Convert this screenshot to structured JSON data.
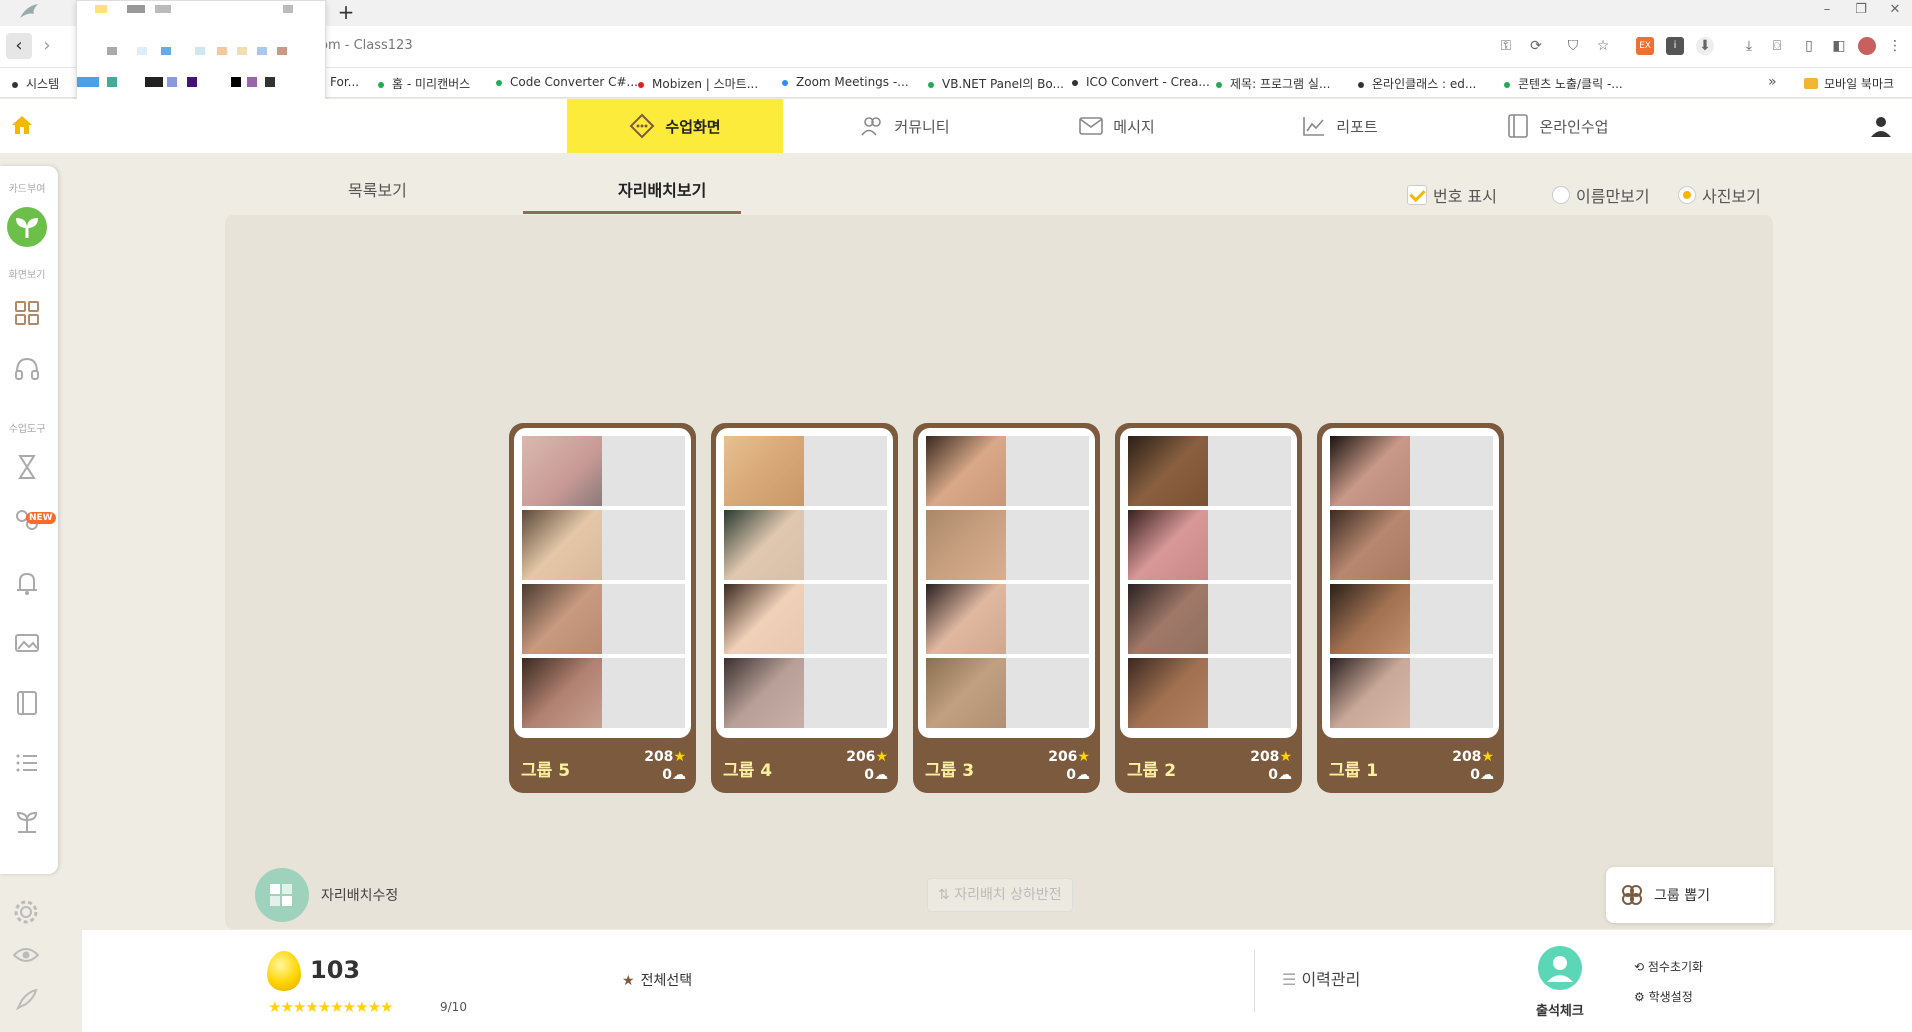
{
  "browser": {
    "tab_new": "+",
    "url": "om - Class123",
    "window_controls": {
      "minimize": "–",
      "restore": "❐",
      "close": "✕"
    },
    "bookmarks": [
      {
        "label": "시스템",
        "dot": "#333333"
      },
      {
        "label": "For...",
        "dot": "#333333"
      },
      {
        "label": "홈 - 미리캔버스",
        "dot": "#22aa55"
      },
      {
        "label": "Code Converter C#...",
        "dot": "#22aa55"
      },
      {
        "label": "Mobizen | 스마트...",
        "dot": "#e02020"
      },
      {
        "label": "Zoom Meetings -...",
        "dot": "#2d8cff"
      },
      {
        "label": "VB.NET Panel의 Bo...",
        "dot": "#22aa55"
      },
      {
        "label": "ICO Convert - Crea...",
        "dot": "#333333"
      },
      {
        "label": "제목: 프로그램 실...",
        "dot": "#22aa55"
      },
      {
        "label": "온라인클래스 : ed...",
        "dot": "#333333"
      },
      {
        "label": "콘텐츠 노출/클릭 -...",
        "dot": "#22aa55"
      }
    ],
    "bookmarks_more": "»",
    "bookmarks_mobile": "모바일 북마크"
  },
  "header": {
    "nav": [
      {
        "label": "수업화면",
        "active": true,
        "icon": "class-screen-icon"
      },
      {
        "label": "커뮤니티",
        "active": false,
        "icon": "community-icon"
      },
      {
        "label": "메시지",
        "active": false,
        "icon": "message-icon"
      },
      {
        "label": "리포트",
        "active": false,
        "icon": "report-icon"
      },
      {
        "label": "온라인수업",
        "active": false,
        "icon": "online-class-icon"
      }
    ]
  },
  "sidebar": {
    "label_card": "카드부여",
    "label_view": "화면보기",
    "label_tools": "수업도구",
    "new_badge": "NEW"
  },
  "view": {
    "tab_list": "목록보기",
    "tab_seat": "자리배치보기",
    "opt_number": "번호 표시",
    "opt_name_only": "이름만보기",
    "opt_photo": "사진보기"
  },
  "groups": [
    {
      "name": "그룹 5",
      "stars": "208",
      "clouds": "0"
    },
    {
      "name": "그룹 4",
      "stars": "206",
      "clouds": "0"
    },
    {
      "name": "그룹 3",
      "stars": "206",
      "clouds": "0"
    },
    {
      "name": "그룹 2",
      "stars": "208",
      "clouds": "0"
    },
    {
      "name": "그룹 1",
      "stars": "208",
      "clouds": "0"
    }
  ],
  "board": {
    "seat_edit": "자리배치수정",
    "seat_flip": "자리배치 상하반전",
    "group_draw": "그룹 뽑기"
  },
  "bottom": {
    "egg_count": "103",
    "stars_row": "★★★★★★★★★★",
    "stars_count": "9/10",
    "select_all": "전체선택",
    "history": "이력관리",
    "attendance": "출석체크",
    "reset_score": "점수초기화",
    "student_settings": "학생설정"
  },
  "colors": {
    "accent_yellow": "#fdeb3c",
    "group_brown": "#7c5a3e",
    "board_bg": "#e7e3d8",
    "attendance_teal": "#5bd6b6"
  }
}
